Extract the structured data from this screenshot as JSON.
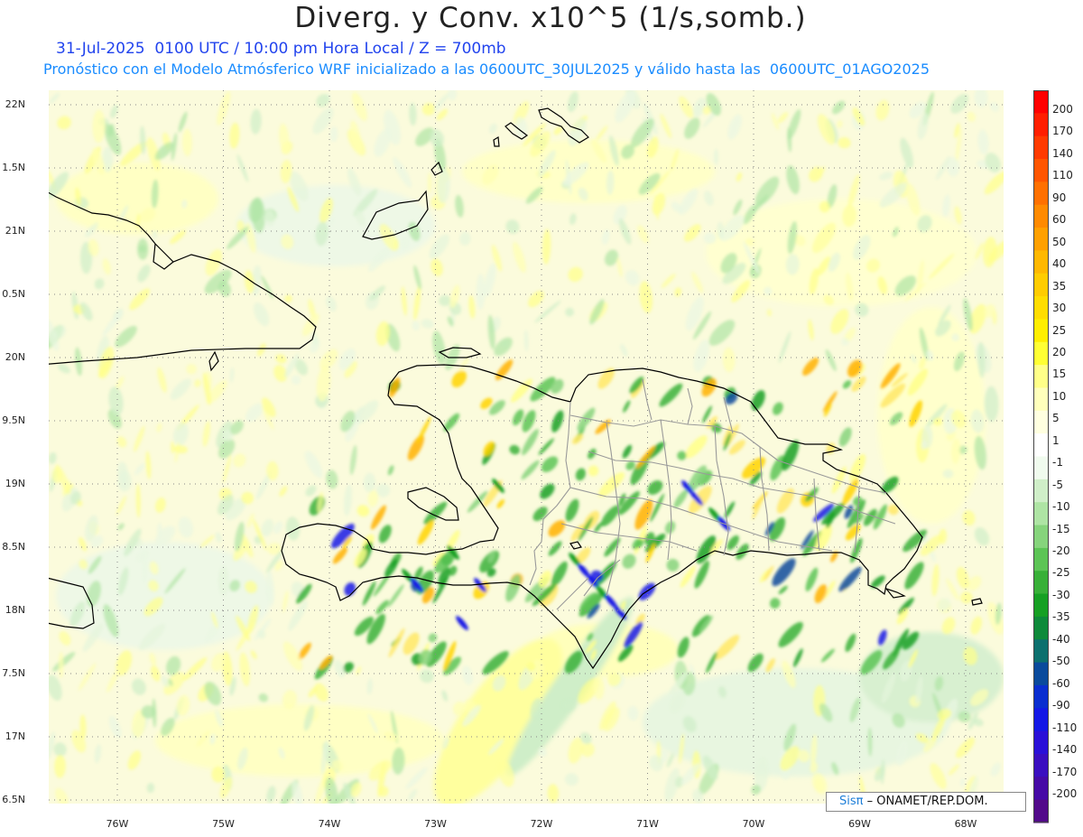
{
  "title": "Diverg. y Conv. x10^5 (1/s,somb.)",
  "subtitle_line1": "31-Jul-2025  0100 UTC / 10:00 pm Hora Local / Z = 700mb",
  "subtitle_line2": "Pronóstico con el Modelo Atmósferico WRF inicializado a las 0600UTC_30JUL2025 y válido hasta las  0600UTC_01AGO2025",
  "lat_labels": [
    "22N",
    "1.5N",
    "21N",
    "0.5N",
    "20N",
    "9.5N",
    "19N",
    "8.5N",
    "18N",
    "7.5N",
    "17N",
    "6.5N"
  ],
  "lon_labels": [
    "76W",
    "75W",
    "74W",
    "73W",
    "72W",
    "71W",
    "70W",
    "69W",
    "68W"
  ],
  "colorbar": {
    "labels": [
      "200",
      "170",
      "140",
      "110",
      "90",
      "60",
      "50",
      "40",
      "35",
      "30",
      "25",
      "20",
      "15",
      "10",
      "5",
      "1",
      "-1",
      "-5",
      "-10",
      "-15",
      "-20",
      "-25",
      "-30",
      "-35",
      "-40",
      "-50",
      "-60",
      "-90",
      "-110",
      "-140",
      "-170",
      "-200"
    ],
    "colors": [
      "#ff0000",
      "#ff1e00",
      "#ff3a00",
      "#ff5500",
      "#ff7000",
      "#ff8a00",
      "#ffa000",
      "#ffb800",
      "#ffcc00",
      "#ffdd00",
      "#ffee00",
      "#ffff33",
      "#ffff88",
      "#ffffbb",
      "#ffffe0",
      "#ffffff",
      "#f0fbee",
      "#cfeec8",
      "#aee4a4",
      "#86d47c",
      "#5cc455",
      "#38b038",
      "#16a023",
      "#0e8a3a",
      "#0c706e",
      "#0a4a9c",
      "#0a2ed0",
      "#1418e6",
      "#2a10d8",
      "#3a0ec0",
      "#460aa6",
      "#520a8a"
    ]
  },
  "credit": {
    "brand": "Sisπ",
    "text": "– ONAMET/REP.DOM."
  },
  "map": {
    "land_outline_color": "#000000",
    "border_color": "#9a9a9a",
    "background_tint": "#fbfbd8",
    "grid_line_color": "#888888"
  }
}
